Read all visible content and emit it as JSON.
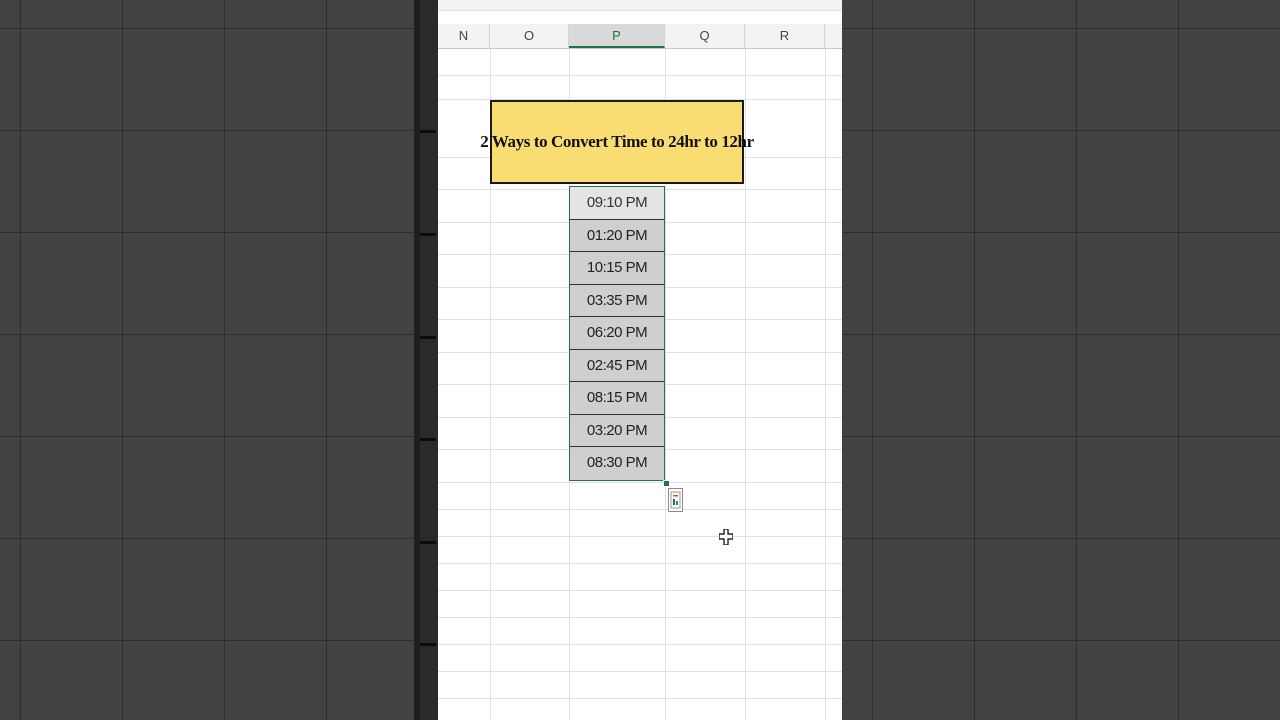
{
  "columns": [
    {
      "label": "N",
      "active": false
    },
    {
      "label": "O",
      "active": false
    },
    {
      "label": "P",
      "active": true
    },
    {
      "label": "Q",
      "active": false
    },
    {
      "label": "R",
      "active": false
    }
  ],
  "title_cell": "2 Ways to Convert Time to 24hr to 12hr",
  "time_values": [
    "09:10 PM",
    "01:20 PM",
    "10:15 PM",
    "03:35 PM",
    "06:20 PM",
    "02:45 PM",
    "08:15 PM",
    "03:20 PM",
    "08:30 PM"
  ],
  "icons": {
    "quick_analysis": "quick-analysis-icon",
    "cursor": "cell-select-cursor-icon"
  },
  "colors": {
    "title_fill": "#f9dd72",
    "selection_border": "#217346",
    "selected_cells": "#cfcfcf"
  }
}
